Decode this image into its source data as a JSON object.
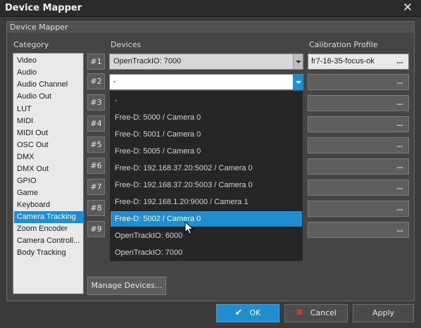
{
  "window": {
    "title": "Device Mapper",
    "close_icon": "close-icon"
  },
  "group": {
    "title": "Device Mapper"
  },
  "columns": {
    "category": "Category",
    "devices": "Devices",
    "calibration": "Calibration Profile"
  },
  "categories": [
    "Video",
    "Audio",
    "Audio Channel",
    "Audio Out",
    "LUT",
    "MIDI",
    "MIDI Out",
    "OSC Out",
    "DMX",
    "DMX Out",
    "GPIO",
    "Game",
    "Keyboard",
    "Camera Tracking",
    "Zoom Encoder",
    "Camera Controll...",
    "Body Tracking"
  ],
  "selected_category": "Camera Tracking",
  "slots": [
    {
      "label": "#1",
      "device": "OpenTrackIO: 7000",
      "calibration": "fr7-16-35-focus-ok"
    },
    {
      "label": "#2",
      "device": "-",
      "calibration": ""
    },
    {
      "label": "#3",
      "calibration": ""
    },
    {
      "label": "#4",
      "calibration": ""
    },
    {
      "label": "#5",
      "calibration": ""
    },
    {
      "label": "#6",
      "calibration": ""
    },
    {
      "label": "#7",
      "calibration": ""
    },
    {
      "label": "#8",
      "calibration": ""
    },
    {
      "label": "#9",
      "calibration": ""
    }
  ],
  "calibration_button": "...",
  "dropdown": {
    "options": [
      "-",
      "Free-D: 5000 / Camera 0",
      "Free-D: 5001 / Camera 0",
      "Free-D: 5005 / Camera 0",
      "Free-D: 192.168.37.20:5002 / Camera 0",
      "Free-D: 192.168.37.20:5003 / Camera 0",
      "Free-D: 192.168.1.20:9000 / Camera 1",
      "Free-D: 5002 / Camera 0",
      "OpenTrackIO: 6000",
      "OpenTrackIO: 7000"
    ],
    "highlighted": "Free-D: 5002 / Camera 0"
  },
  "buttons": {
    "manage": "Manage Devices...",
    "ok": "OK",
    "cancel": "Cancel",
    "apply": "Apply"
  },
  "colors": {
    "accent": "#1e8ed0",
    "background": "#3b3b3b",
    "cancel_icon": "#e0392b"
  }
}
